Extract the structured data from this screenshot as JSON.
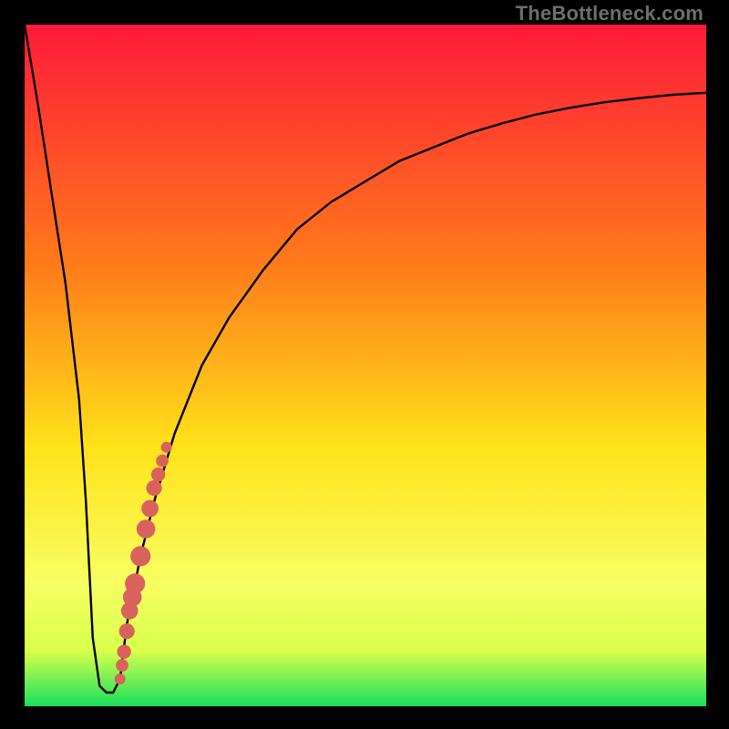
{
  "watermark": "TheBottleneck.com",
  "colors": {
    "curve": "#000000",
    "dots": "#d9635c",
    "frame": "#000000",
    "gradient_top": "#ff1a3a",
    "gradient_mid1": "#ff7a1a",
    "gradient_mid2": "#ffe21a",
    "gradient_low": "#f7ff63",
    "gradient_band": "#d7ff4a",
    "gradient_bottom": "#18e05c"
  },
  "chart_data": {
    "type": "line",
    "title": "",
    "xlabel": "",
    "ylabel": "",
    "xlim": [
      0,
      100
    ],
    "ylim": [
      0,
      100
    ],
    "series": [
      {
        "name": "bottleneck-curve",
        "x": [
          0,
          2,
          4,
          6,
          8,
          9,
          10,
          11,
          12,
          13,
          14,
          15,
          17,
          19,
          22,
          26,
          30,
          35,
          40,
          45,
          50,
          55,
          60,
          65,
          70,
          75,
          80,
          85,
          90,
          95,
          100
        ],
        "y": [
          100,
          88,
          75,
          62,
          45,
          30,
          10,
          3,
          2,
          2,
          4,
          12,
          22,
          30,
          40,
          50,
          57,
          64,
          70,
          74,
          77,
          80,
          82,
          84,
          85.5,
          86.8,
          87.8,
          88.6,
          89.2,
          89.7,
          90
        ]
      }
    ],
    "dot_cluster": {
      "name": "highlighted-range",
      "points": [
        {
          "x": 14.0,
          "y": 4
        },
        {
          "x": 14.3,
          "y": 6
        },
        {
          "x": 14.6,
          "y": 8
        },
        {
          "x": 15.0,
          "y": 11
        },
        {
          "x": 15.4,
          "y": 14
        },
        {
          "x": 15.8,
          "y": 16
        },
        {
          "x": 16.2,
          "y": 18
        },
        {
          "x": 17.0,
          "y": 22
        },
        {
          "x": 17.8,
          "y": 26
        },
        {
          "x": 18.4,
          "y": 29
        },
        {
          "x": 19.0,
          "y": 32
        },
        {
          "x": 19.6,
          "y": 34
        },
        {
          "x": 20.2,
          "y": 36
        },
        {
          "x": 20.8,
          "y": 38
        }
      ]
    }
  }
}
